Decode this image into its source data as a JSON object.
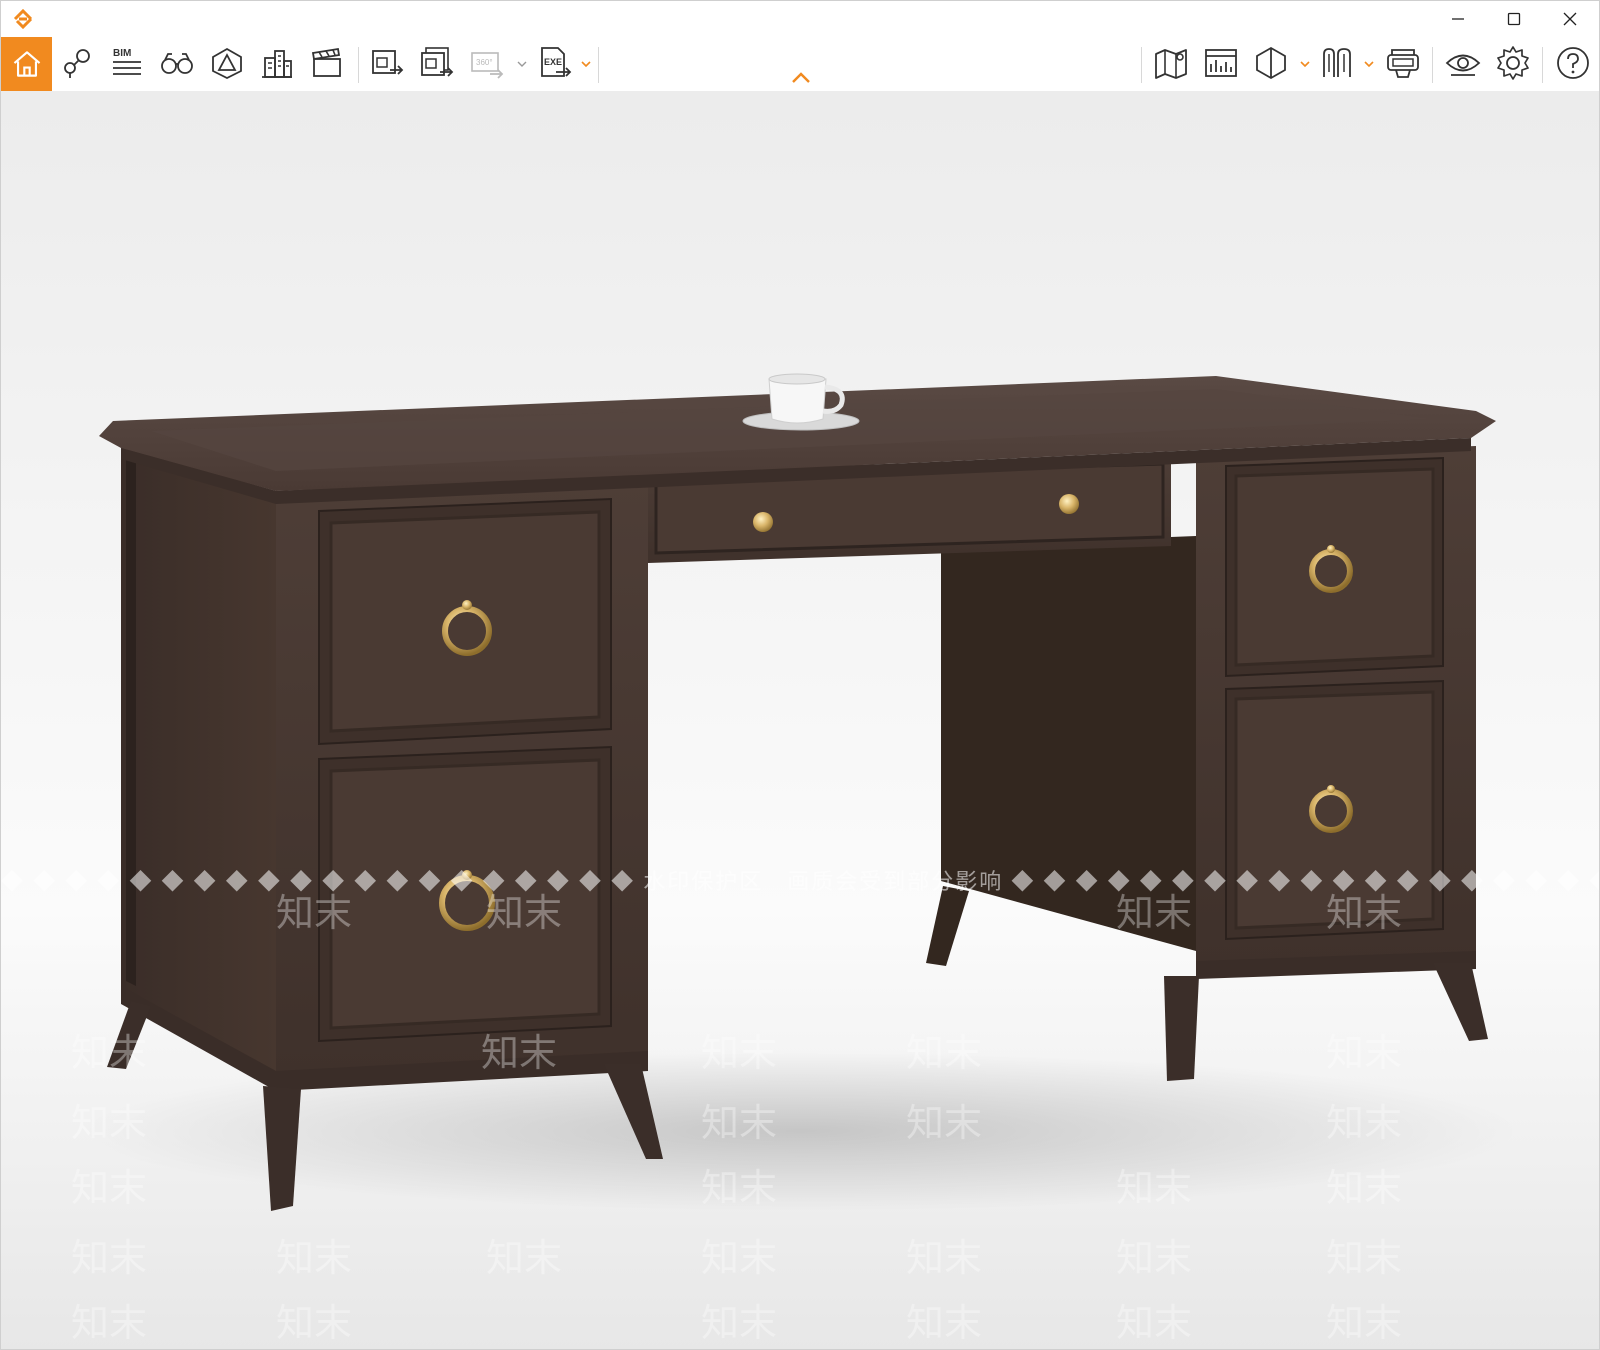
{
  "titlebar": {
    "controls": [
      "minimize",
      "maximize",
      "close"
    ]
  },
  "toolbar": {
    "left_tools": [
      {
        "icon": "home-icon",
        "active": true
      },
      {
        "icon": "location-pin-icon"
      },
      {
        "icon": "bim-icon",
        "label": "BIM"
      },
      {
        "icon": "binoculars-icon"
      },
      {
        "icon": "perspective-icon"
      },
      {
        "icon": "buildings-icon"
      },
      {
        "icon": "clapperboard-icon"
      },
      {
        "icon": "export-image-icon"
      },
      {
        "icon": "export-batch-icon"
      },
      {
        "icon": "export-360-icon",
        "label": "360°",
        "disabled": true
      },
      {
        "icon": "export-exe-icon",
        "label": "EXE"
      }
    ],
    "right_tools": [
      {
        "icon": "map-icon"
      },
      {
        "icon": "dashboard-icon"
      },
      {
        "icon": "section-box-icon"
      },
      {
        "icon": "measure-icon"
      },
      {
        "icon": "vr-headset-icon"
      },
      {
        "icon": "eye-icon"
      },
      {
        "icon": "settings-icon"
      },
      {
        "icon": "help-icon"
      }
    ],
    "accent_color": "#f18a1f"
  },
  "viewport": {
    "watermark_banner": "◆ ◆ ◆ ◆ ◆ ◆ ◆ ◆ ◆ ◆ ◆ ◆ ◆ ◆ ◆ ◆ ◆ ◆ ◆ ◆ 水印保护区　画质会受到部分影响 ◆ ◆ ◆ ◆ ◆ ◆ ◆ ◆ ◆ ◆ ◆ ◆ ◆ ◆ ◆ ◆ ◆ ◆ ◆ ◆",
    "watermark_text": "知末",
    "wood_color": "#4a3a33",
    "brass_color": "#d9b56a"
  }
}
